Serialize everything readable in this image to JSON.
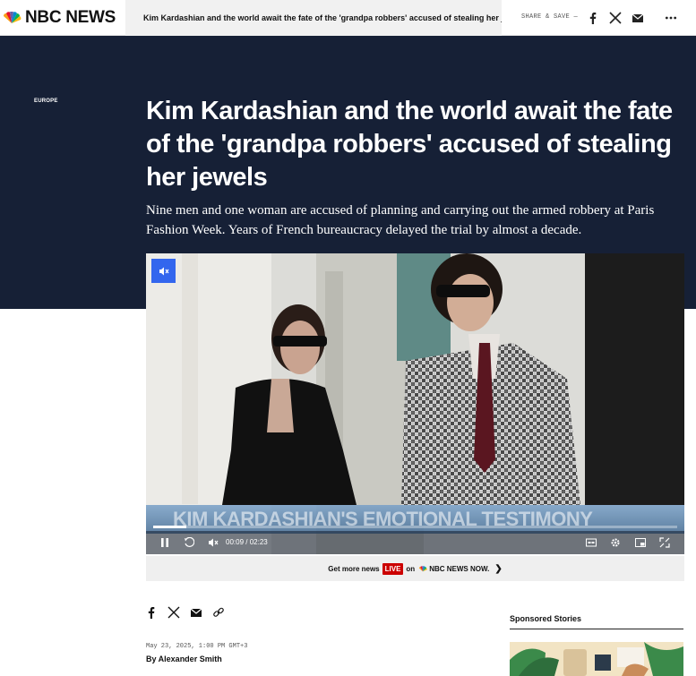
{
  "header": {
    "logo_text": "NBC NEWS",
    "article_headline": "Kim Kardashian and the world await the fate of the 'grandpa robbers' accused of stealing her jewels",
    "share_label": "SHARE & SAVE —",
    "icons": [
      "facebook-icon",
      "x-icon",
      "mail-icon",
      "more-icon"
    ]
  },
  "article": {
    "section": "EUROPE",
    "headline": "Kim Kardashian and the world await the fate of the 'grandpa robbers' accused of stealing her jewels",
    "dek": "Nine men and one woman are accused of planning and carrying out the armed robbery at Paris Fashion Week. Years of French bureaucracy delayed the trial by almost a decade.",
    "date": "May 23, 2025, 1:00 PM GMT+3",
    "byline": "By Alexander Smith"
  },
  "video": {
    "lower_third": "KIM KARDASHIAN'S EMOTIONAL TESTIMONY",
    "time_current": "00:09",
    "time_separator": "/",
    "time_total": "02:23",
    "progress": 0.063
  },
  "promo": {
    "prefix": "Get more news",
    "live": "LIVE",
    "on": "on",
    "channel": "NBC NEWS NOW."
  },
  "sidebar": {
    "sponsored_label": "Sponsored Stories"
  },
  "colors": {
    "hero_bg": "#162036",
    "mute_button": "#3366ee",
    "live_red": "#cc0000"
  }
}
